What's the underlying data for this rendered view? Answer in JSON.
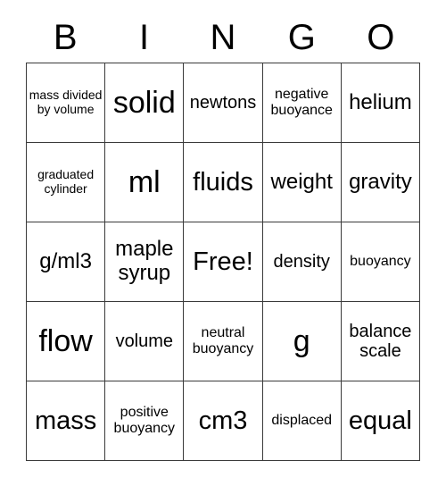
{
  "card": {
    "headers": [
      "B",
      "I",
      "N",
      "G",
      "O"
    ],
    "rows": [
      [
        {
          "text": "mass divided by volume",
          "size": "xs"
        },
        {
          "text": "solid",
          "size": "xxl"
        },
        {
          "text": "newtons",
          "size": "m"
        },
        {
          "text": "negative buoyance",
          "size": "s"
        },
        {
          "text": "helium",
          "size": "l"
        }
      ],
      [
        {
          "text": "graduated cylinder",
          "size": "xs"
        },
        {
          "text": "ml",
          "size": "xxl"
        },
        {
          "text": "fluids",
          "size": "xl"
        },
        {
          "text": "weight",
          "size": "l"
        },
        {
          "text": "gravity",
          "size": "l"
        }
      ],
      [
        {
          "text": "g/ml3",
          "size": "l"
        },
        {
          "text": "maple syrup",
          "size": "l"
        },
        {
          "text": "Free!",
          "size": "xl"
        },
        {
          "text": "density",
          "size": "m"
        },
        {
          "text": "buoyancy",
          "size": "s"
        }
      ],
      [
        {
          "text": "flow",
          "size": "xxl"
        },
        {
          "text": "volume",
          "size": "m"
        },
        {
          "text": "neutral buoyancy",
          "size": "s"
        },
        {
          "text": "g",
          "size": "xxl"
        },
        {
          "text": "balance scale",
          "size": "m"
        }
      ],
      [
        {
          "text": "mass",
          "size": "xl"
        },
        {
          "text": "positive buoyancy",
          "size": "s"
        },
        {
          "text": "cm3",
          "size": "xl"
        },
        {
          "text": "displaced",
          "size": "s"
        },
        {
          "text": "equal",
          "size": "xl"
        }
      ]
    ]
  },
  "colors": {
    "background": "#ffffff",
    "text": "#000000",
    "grid_line": "#3a3a3a"
  }
}
